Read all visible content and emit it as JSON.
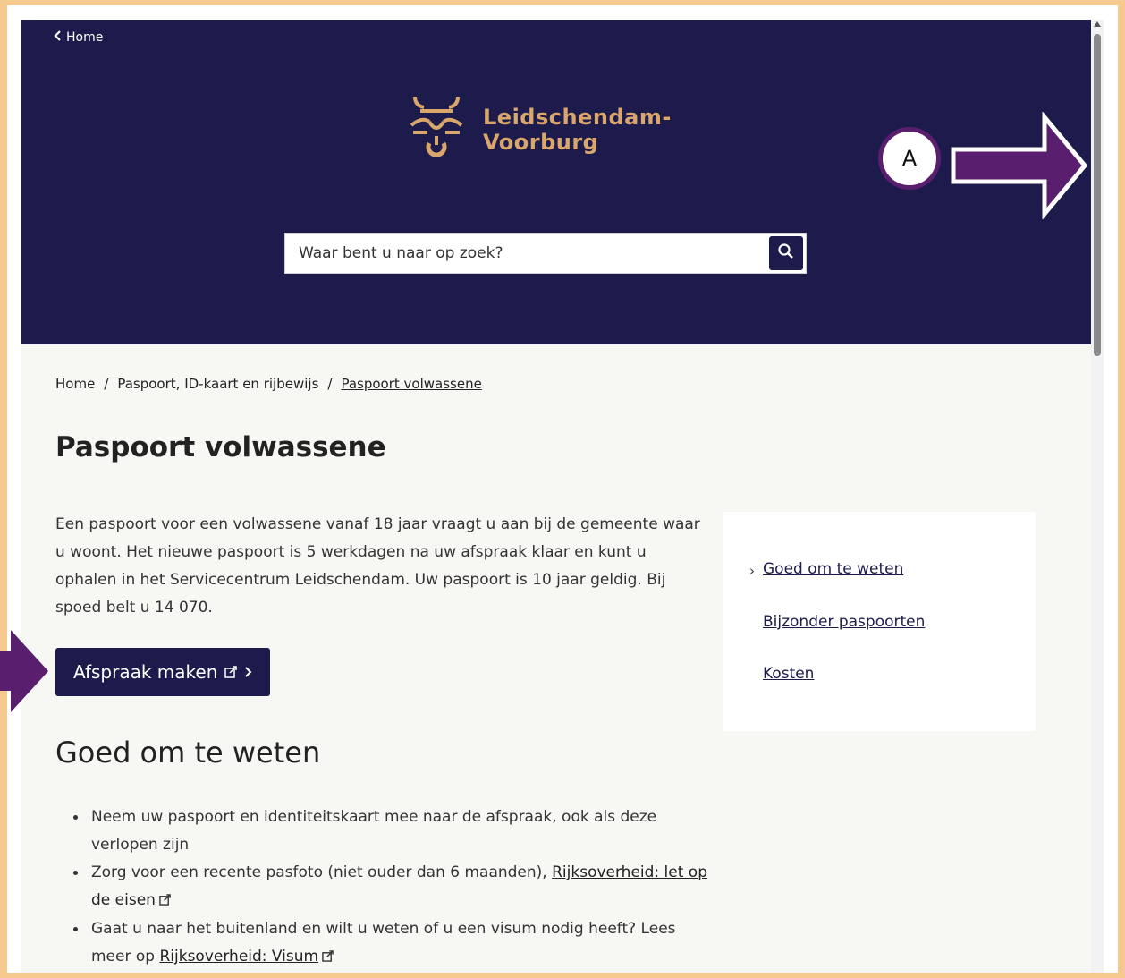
{
  "header": {
    "home_label": "Home",
    "logo_line1": "Leidschendam-",
    "logo_line2": "Voorburg",
    "search_placeholder": "Waar bent u naar op zoek?"
  },
  "breadcrumb": {
    "items": [
      "Home",
      "Paspoort, ID-kaart en rijbewijs",
      "Paspoort volwassene"
    ],
    "separator": "/"
  },
  "page": {
    "title": "Paspoort volwassene",
    "intro": "Een paspoort voor een volwassene vanaf 18 jaar vraagt u aan bij de gemeente waar u woont. Het nieuwe paspoort is 5 werkdagen na uw afspraak klaar en kunt u ophalen in het Servicecentrum Leidschendam. Uw paspoort is 10 jaar geldig. Bij spoed belt u 14 070.",
    "cta_label": "Afspraak maken"
  },
  "sidebar": {
    "items": [
      "Goed om te weten",
      "Bijzonder paspoorten",
      "Kosten"
    ]
  },
  "section": {
    "title": "Goed om te weten",
    "bullets": [
      {
        "text": "Neem uw paspoort en identiteitskaart mee naar de afspraak, ook als deze verlopen zijn",
        "link": ""
      },
      {
        "text": "Zorg voor een recente pasfoto (niet ouder dan 6 maanden), ",
        "link": "Rijksoverheid: let op de eisen"
      },
      {
        "text": "Gaat u naar het buitenland en wilt u weten of u een visum nodig heeft? Lees meer op ",
        "link": "Rijksoverheid: Visum"
      }
    ]
  },
  "annotation": {
    "label": "A",
    "color": "#5a1e6e"
  },
  "colors": {
    "header_bg": "#1c1b4b",
    "logo": "#d9a66b",
    "frame": "#f6c98f"
  },
  "icons": [
    "chevron-left-icon",
    "crest-logo-icon",
    "search-icon",
    "external-link-icon",
    "chevron-right-icon",
    "scroll-arrow-icon"
  ]
}
